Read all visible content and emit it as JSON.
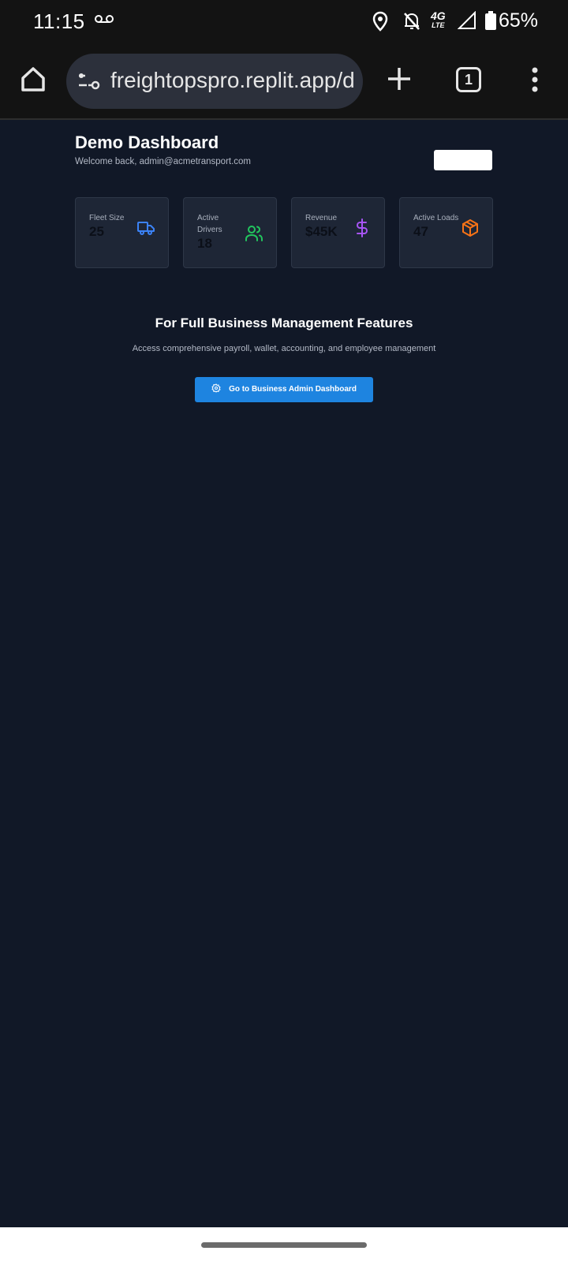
{
  "status_bar": {
    "time": "11:15",
    "network": "4G",
    "network_sub": "LTE",
    "battery": "65%",
    "icons": [
      "voicemail-icon",
      "location-icon",
      "bell-off-icon",
      "signal-icon",
      "battery-icon"
    ]
  },
  "browser": {
    "url": "freightopspro.replit.app/dashboard",
    "tab_count": "1",
    "icons": [
      "home-icon",
      "site-settings-icon",
      "plus-icon",
      "tabs-icon",
      "more-vert-icon"
    ]
  },
  "dashboard": {
    "title": "Demo Dashboard",
    "welcome": "Welcome back, admin@acmetransport.com",
    "stats": [
      {
        "label": "Fleet Size",
        "value": "25",
        "icon": "truck-icon",
        "color": "#3b82f6"
      },
      {
        "label": "Active Drivers",
        "value": "18",
        "icon": "users-icon",
        "color": "#22c55e"
      },
      {
        "label": "Revenue",
        "value": "$45K",
        "icon": "dollar-icon",
        "color": "#a855f7"
      },
      {
        "label": "Active Loads",
        "value": "47",
        "icon": "package-icon",
        "color": "#f97316"
      }
    ]
  },
  "promo": {
    "title": "For Full Business Management Features",
    "description": "Access comprehensive payroll, wallet, accounting, and employee management",
    "button_label": "Go to Business Admin Dashboard",
    "button_icon": "settings-icon",
    "button_color": "#1e84e0"
  }
}
